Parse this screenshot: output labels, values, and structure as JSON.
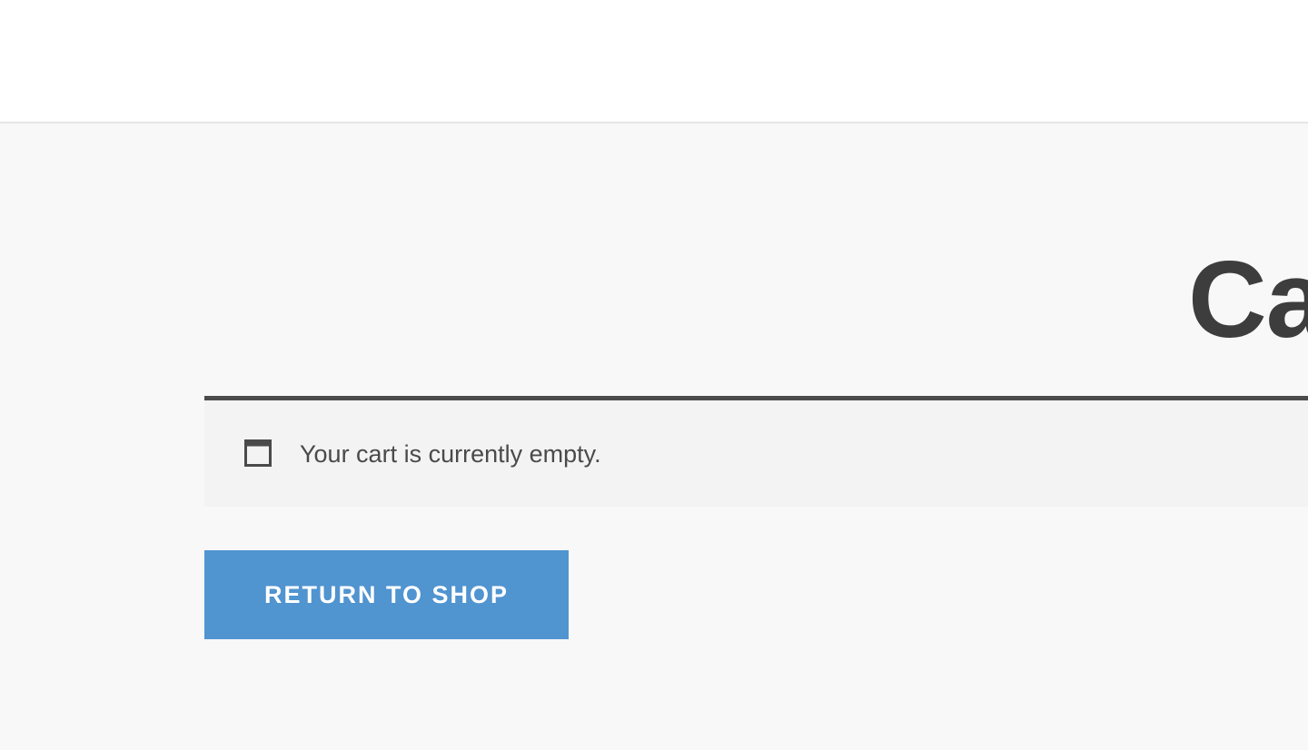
{
  "header": {},
  "page": {
    "title": "Ca"
  },
  "notice": {
    "icon": "window-icon",
    "message": "Your cart is currently empty."
  },
  "actions": {
    "return_to_shop_label": "RETURN TO SHOP"
  },
  "colors": {
    "accent": "#5094d0",
    "title": "#3d3d3d",
    "notice_border": "#4b4b4b",
    "notice_bg": "#f3f3f3",
    "page_bg": "#f8f8f8"
  }
}
